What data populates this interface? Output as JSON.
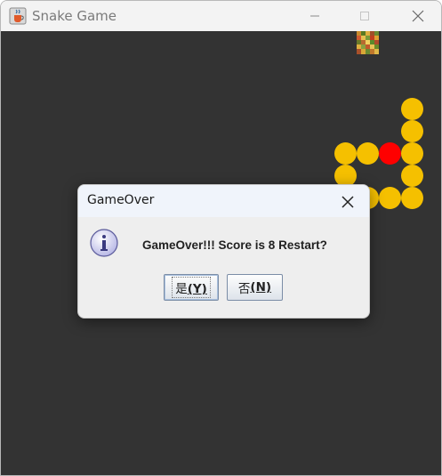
{
  "window": {
    "title": "Snake Game",
    "app_icon": "java-cup-icon",
    "controls": [
      "minimize-icon",
      "maximize-icon",
      "close-icon"
    ]
  },
  "board": {
    "background": "#333333",
    "food_icon": "food-tile-icon",
    "snake_color": "#f5c000",
    "head_color": "#ff0000"
  },
  "dialog": {
    "title": "GameOver",
    "message": "GameOver!!! Score is 8 Restart?",
    "icon": "info-icon",
    "buttons": {
      "yes_label": "是",
      "yes_mnemonic": "(Y)",
      "no_label": "否",
      "no_mnemonic": "(N)"
    }
  }
}
